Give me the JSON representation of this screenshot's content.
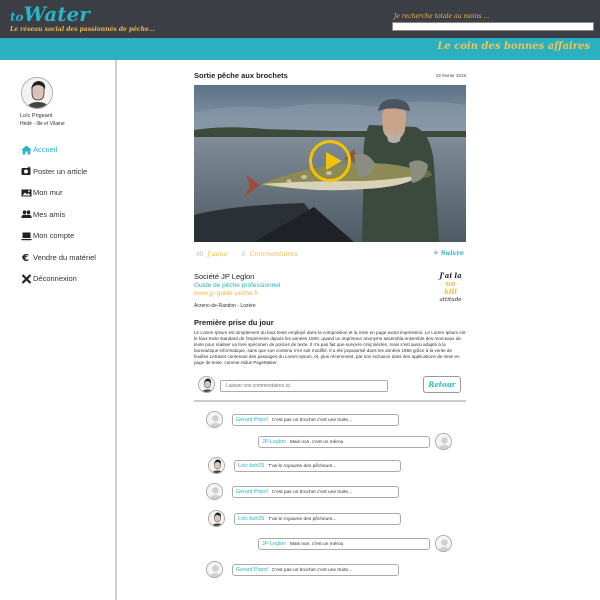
{
  "header": {
    "logo_prefix": "to",
    "logo_main": "Water",
    "tagline": "Le réseau social des passionnés de pêche...",
    "search_label": "Je recherche totale au moins ...",
    "search_placeholder": "",
    "corner_link": "Le coin des bonnes affaires",
    "colors": {
      "dark": "#3b3e45",
      "teal": "#2ab0c0",
      "gold": "#f0b84a"
    }
  },
  "profile": {
    "name": "Loïc Prigeant",
    "location": "Hédé - Ille et Vilaine"
  },
  "nav": {
    "items": [
      {
        "label": "Accueil",
        "icon": "home-icon",
        "active": true
      },
      {
        "label": "Poster un article",
        "icon": "camera-plus-icon",
        "active": false
      },
      {
        "label": "Mon mur",
        "icon": "picture-icon",
        "active": false
      },
      {
        "label": "Mes amis",
        "icon": "users-icon",
        "active": false
      },
      {
        "label": "Mon compte",
        "icon": "laptop-icon",
        "active": false
      },
      {
        "label": "Vendre du matériel",
        "icon": "euro-icon",
        "active": false
      },
      {
        "label": "Déconnexion",
        "icon": "close-icon",
        "active": false
      }
    ]
  },
  "post": {
    "title": "Sortie pêche aux brochets",
    "date": "02 fevrier 2019",
    "likes_count": "45",
    "likes_label": "J'aime",
    "comments_count": "0",
    "comments_label": "Commentaires",
    "follow_label": "+ Suivre",
    "company": "Société JP Leglon",
    "company_role": "Guide de pêche professionnel",
    "company_url": "www.jp-guide-peche.fr",
    "company_location": "Arzenc-de-Randon - Lozère",
    "badge_lines": [
      "J'ai la",
      "no",
      "kill",
      "attitude"
    ],
    "section_title": "Première prise du jour",
    "body": "Le Lorem Ipsum est simplement du faux texte employé dans la composition et la mise en page avant impression. Le Lorem Ipsum est le faux texte standard de l'imprimerie depuis les années 1500, quand un imprimeur anonyme assembla ensemble des morceaux de texte pour réaliser un livre spécimen de polices de texte. Il n'a pas fait que survivre cinq siècles, mais s'est aussi adapté à la bureautique informatique, sans que son contenu n'en soit modifié. Il a été popularisé dans les années 1960 grâce à la vente de feuilles Letraset contenant des passages du Lorem Ipsum, et, plus récemment, par son inclusion dans des applications de mise en page de texte, comme Aldus PageMaker."
  },
  "comment_box": {
    "placeholder": "Laisser vos commentaires ici",
    "retour_label": "Retour"
  },
  "thread": [
    {
      "author": "Gérard Popof",
      "text": "C'est pas un brochet c'est une truite...",
      "side": "left"
    },
    {
      "author": "JP-Leglon",
      "text": "Mais non, c'est un mérou",
      "side": "right"
    },
    {
      "author": "Loïc-bzh29",
      "text": "T'as le royaume des pêcheurs...",
      "side": "left"
    },
    {
      "author": "Gérard Popof",
      "text": "C'est pas un brochet c'est une truite...",
      "side": "left"
    },
    {
      "author": "Loïc-bzh29",
      "text": "T'as le royaume des pêcheurs...",
      "side": "left"
    },
    {
      "author": "JP-Leglon",
      "text": "Mais non, c'est un mérou",
      "side": "right"
    },
    {
      "author": "Gérard Popof",
      "text": "C'est pas un brochet c'est une truite...",
      "side": "left"
    }
  ]
}
